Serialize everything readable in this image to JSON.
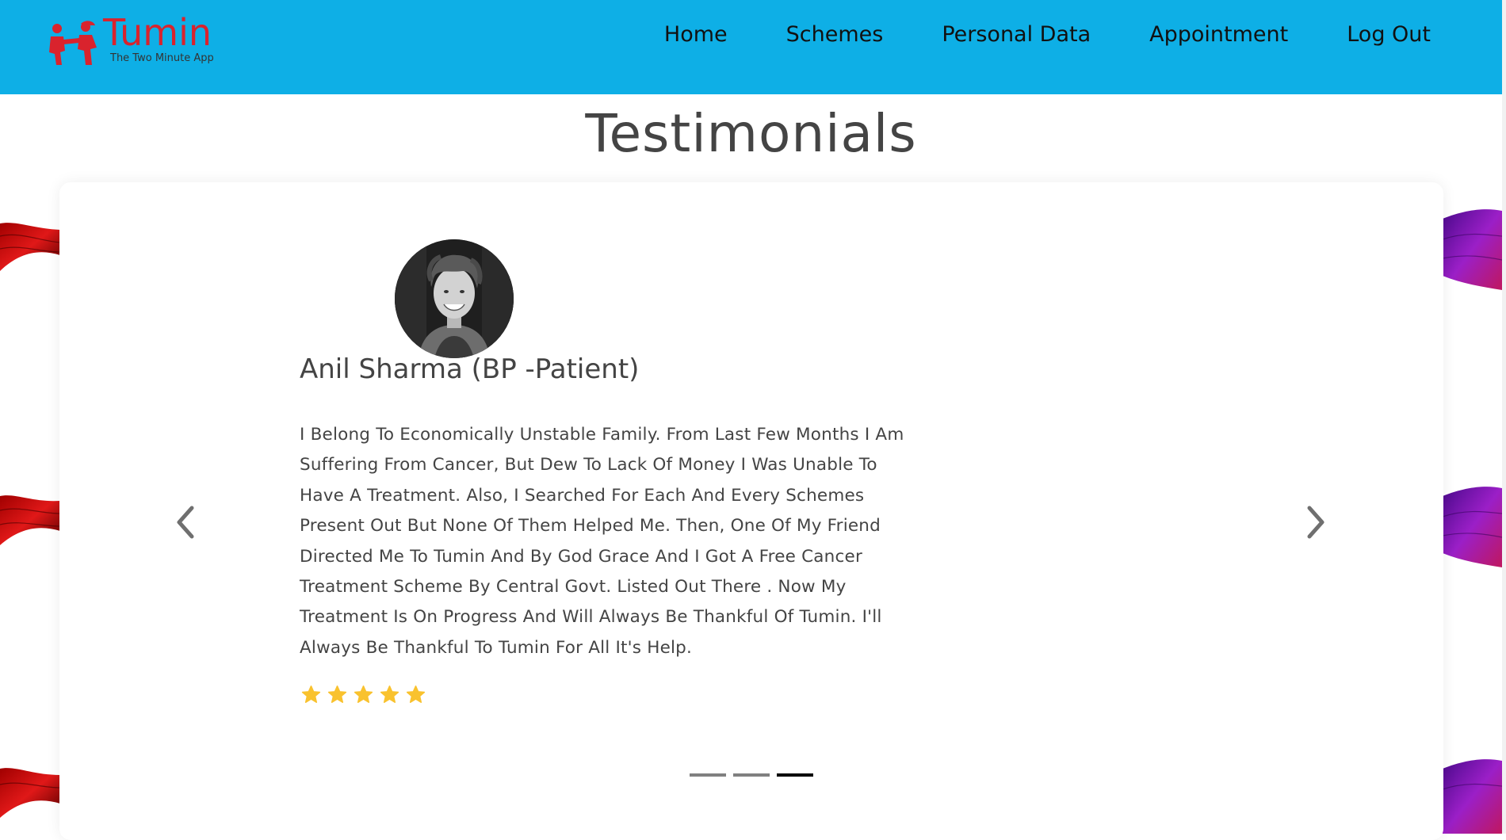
{
  "brand": {
    "name": "Tumin",
    "tagline": "The Two Minute App",
    "color": "#d9232d",
    "header_color": "#0eafe6"
  },
  "nav": {
    "items": [
      "Home",
      "Schemes",
      "Personal Data",
      "Appointment",
      "Log Out"
    ]
  },
  "section": {
    "title": "Testimonials"
  },
  "testimonial": {
    "name": "Anil Sharma (BP -Patient)",
    "text": "I Belong To Economically Unstable Family. From Last Few Months I Am Suffering From Cancer, But Dew To Lack Of Money I Was Unable To Have A Treatment. Also, I Searched For Each And Every Schemes Present Out But None Of Them Helped Me. Then, One Of My Friend Directed Me To Tumin And By God Grace And I Got A Free Cancer Treatment Scheme By Central Govt. Listed Out There . Now My Treatment Is On Progress And Will Always Be Thankful Of Tumin. I'll Always Be Thankful To Tumin For All It's Help.",
    "rating": 5,
    "rating_max": 5,
    "star_color": "#f9c22e"
  },
  "carousel": {
    "slides": 3,
    "active_slide": 3,
    "prev_icon": "chevron-left-icon",
    "next_icon": "chevron-right-icon"
  }
}
